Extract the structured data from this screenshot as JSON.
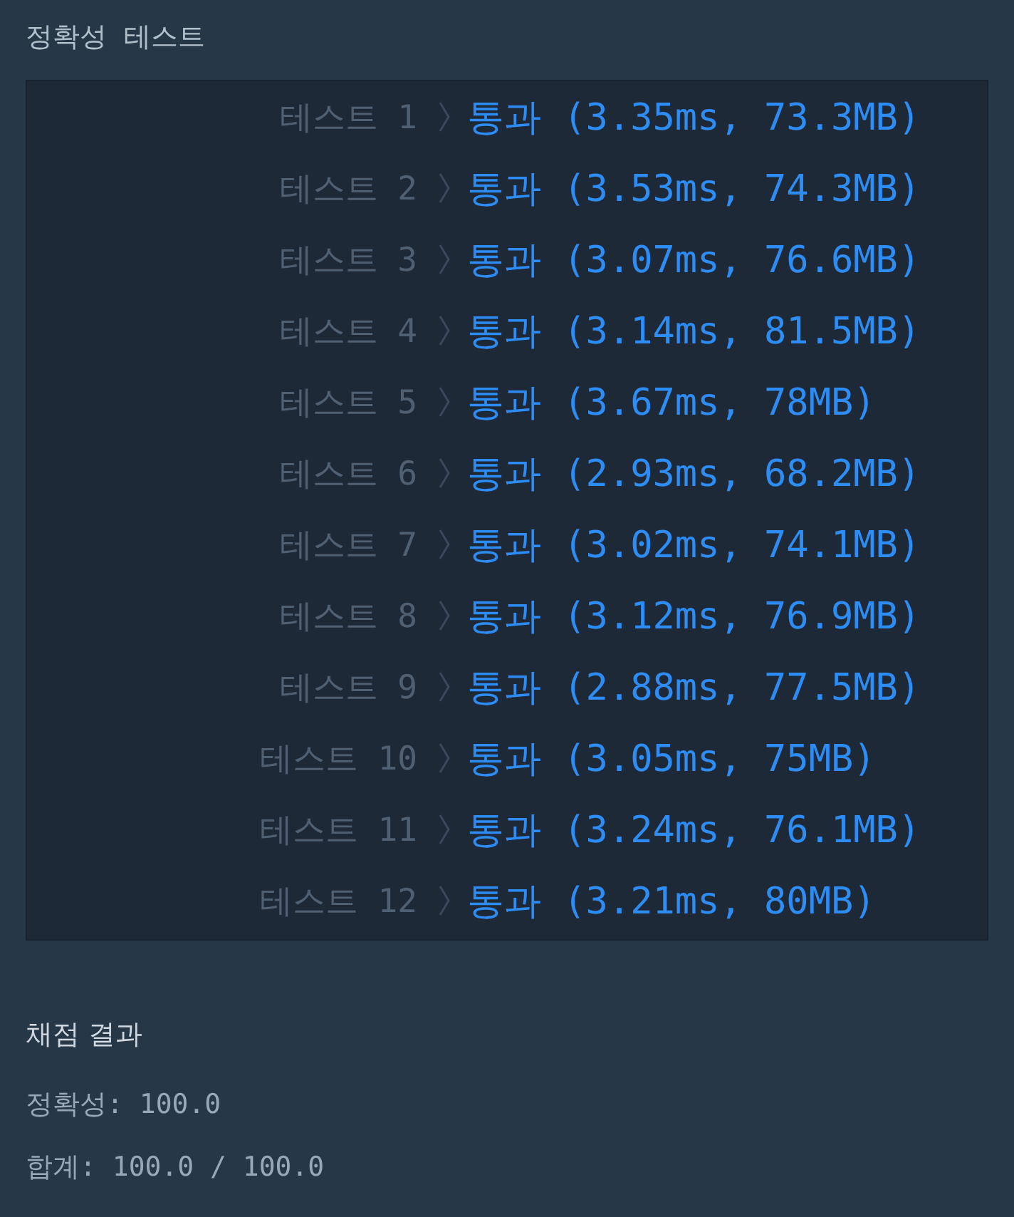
{
  "section_title": "정확성  테스트",
  "tests": [
    {
      "label": "테스트 1",
      "result": "통과 (3.35ms, 73.3MB)"
    },
    {
      "label": "테스트 2",
      "result": "통과 (3.53ms, 74.3MB)"
    },
    {
      "label": "테스트 3",
      "result": "통과 (3.07ms, 76.6MB)"
    },
    {
      "label": "테스트 4",
      "result": "통과 (3.14ms, 81.5MB)"
    },
    {
      "label": "테스트 5",
      "result": "통과 (3.67ms, 78MB)"
    },
    {
      "label": "테스트 6",
      "result": "통과 (2.93ms, 68.2MB)"
    },
    {
      "label": "테스트 7",
      "result": "통과 (3.02ms, 74.1MB)"
    },
    {
      "label": "테스트 8",
      "result": "통과 (3.12ms, 76.9MB)"
    },
    {
      "label": "테스트 9",
      "result": "통과 (2.88ms, 77.5MB)"
    },
    {
      "label": "테스트 10",
      "result": "통과 (3.05ms, 75MB)"
    },
    {
      "label": "테스트 11",
      "result": "통과 (3.24ms, 76.1MB)"
    },
    {
      "label": "테스트 12",
      "result": "통과 (3.21ms, 80MB)"
    }
  ],
  "grading": {
    "title": "채점 결과",
    "lines": [
      "정확성: 100.0",
      "합계: 100.0 / 100.0"
    ]
  }
}
